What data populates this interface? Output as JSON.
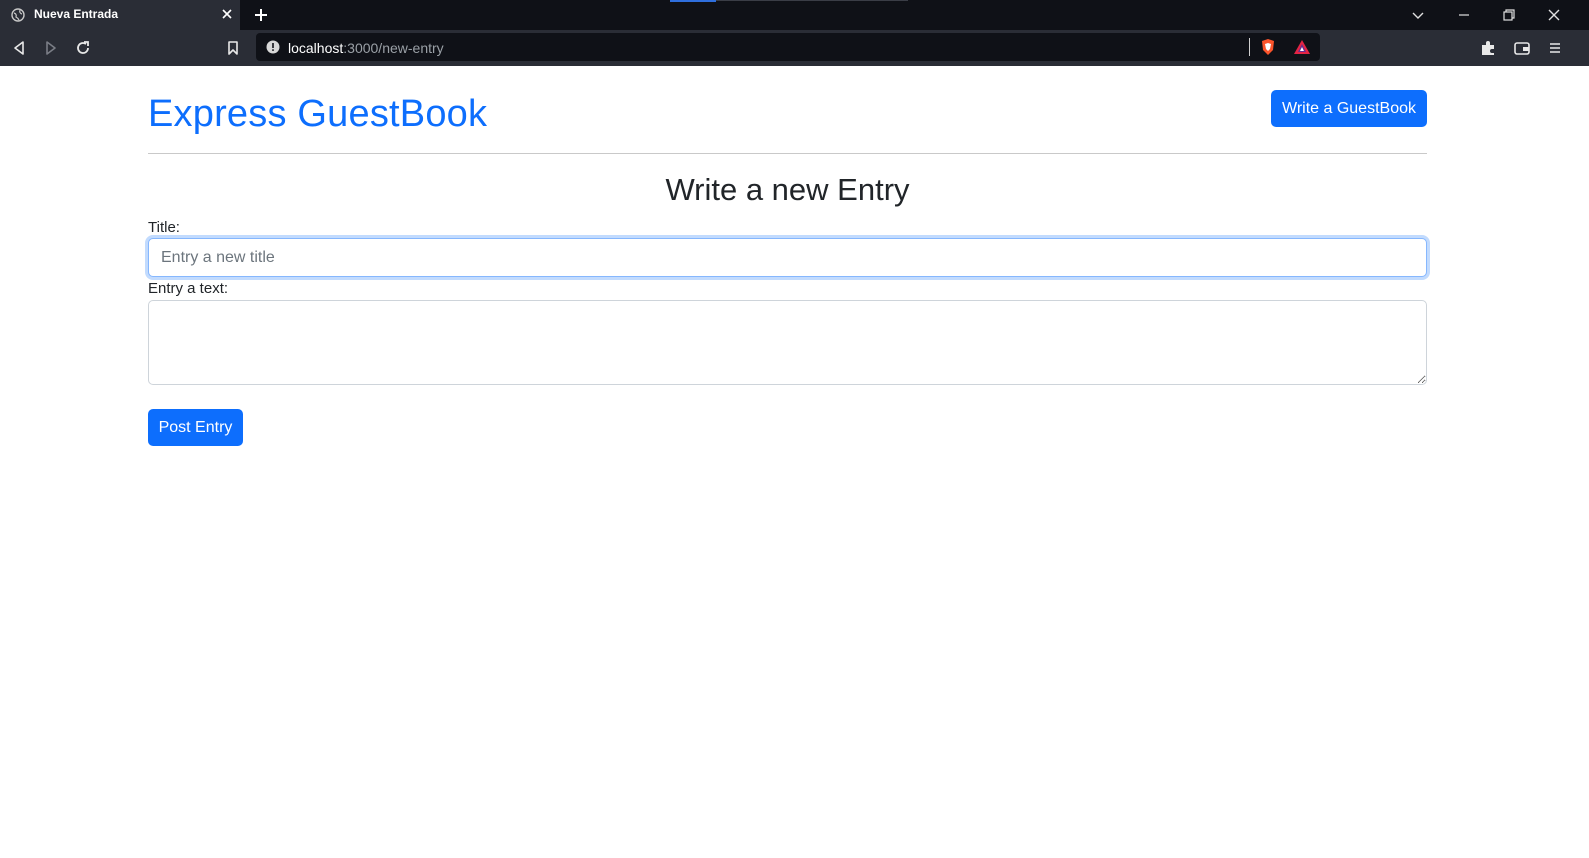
{
  "browser": {
    "tab_title": "Nueva Entrada",
    "url_host": "localhost",
    "url_rest": ":3000/new-entry"
  },
  "header": {
    "brand": "Express GuestBook",
    "write_button": "Write a GuestBook"
  },
  "form": {
    "heading": "Write a new Entry",
    "title_label": "Title:",
    "title_placeholder": "Entry a new title",
    "title_value": "",
    "text_label": "Entry a text:",
    "text_value": "",
    "submit_label": "Post Entry"
  },
  "colors": {
    "primary": "#0d6efd",
    "chrome_dark": "#0f1117",
    "chrome_toolbar": "#2a2d36"
  }
}
